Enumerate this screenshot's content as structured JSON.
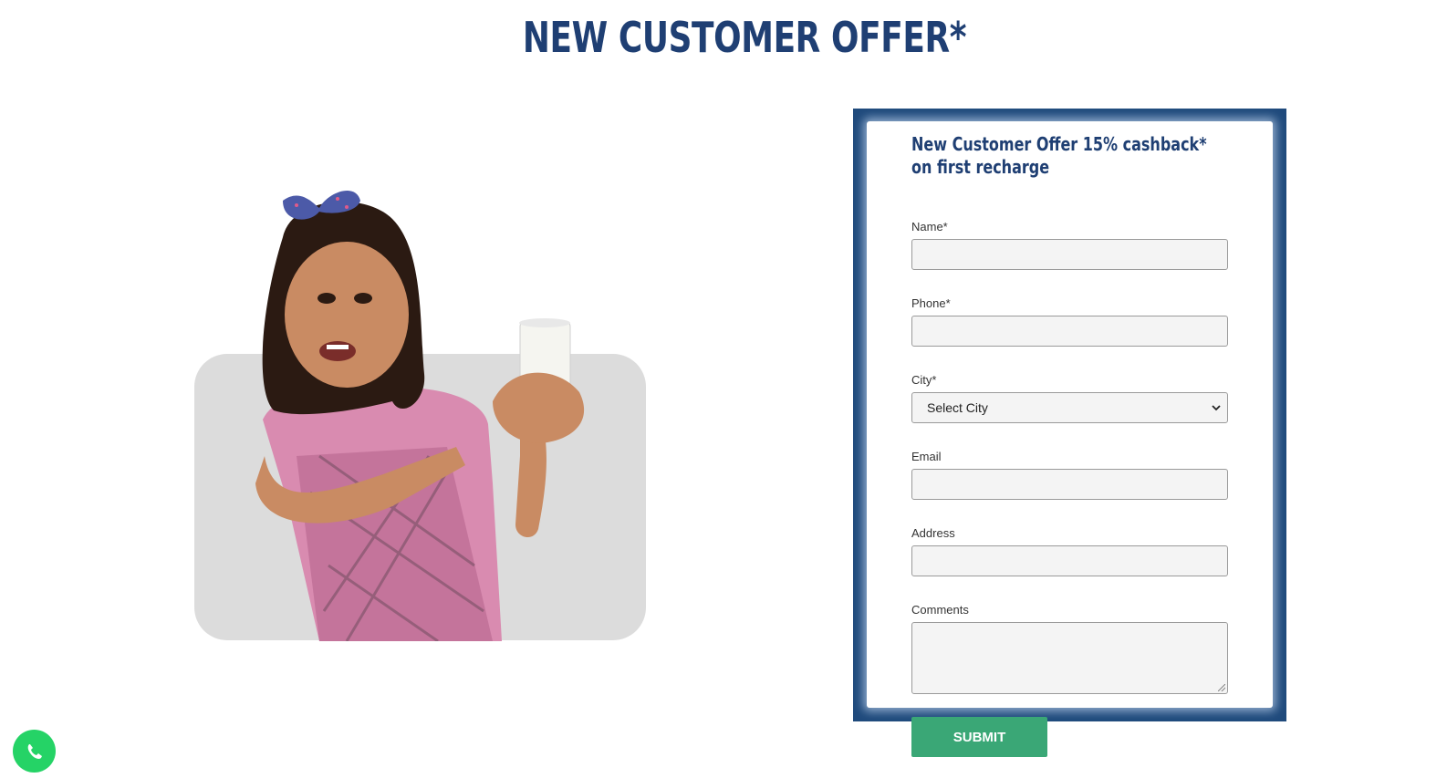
{
  "page": {
    "title": "NEW CUSTOMER OFFER*"
  },
  "form": {
    "heading": "New Customer Offer 15% cashback* on first recharge",
    "fields": {
      "name": {
        "label": "Name*",
        "value": ""
      },
      "phone": {
        "label": "Phone*",
        "value": ""
      },
      "city": {
        "label": "City*",
        "selected": "Select City"
      },
      "email": {
        "label": "Email",
        "value": ""
      },
      "address": {
        "label": "Address",
        "value": ""
      },
      "comments": {
        "label": "Comments",
        "value": ""
      }
    },
    "submit_label": "SUBMIT"
  },
  "icons": {
    "dropdown": "chevron-down-icon",
    "chat": "whatsapp-icon"
  },
  "colors": {
    "heading": "#1f3f73",
    "frame": "#1f4a7c",
    "submit": "#3aa776",
    "whatsapp": "#25d366"
  }
}
